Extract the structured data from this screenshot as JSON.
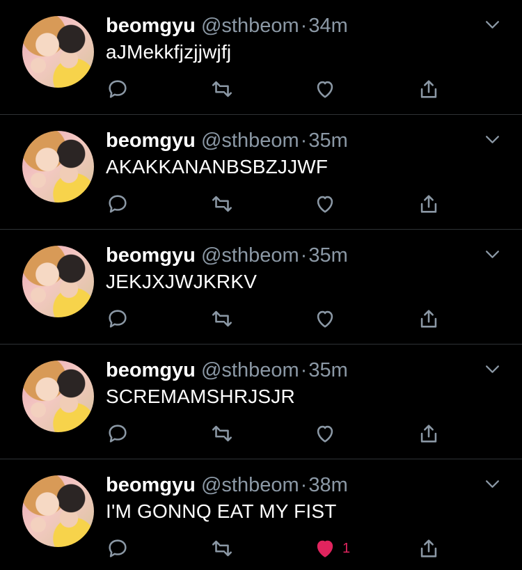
{
  "colors": {
    "background": "#000000",
    "text": "#ffffff",
    "secondary": "#8b98a5",
    "divider": "#2f3336",
    "liked": "#e0245e"
  },
  "icons": {
    "reply": "reply-icon",
    "retweet": "retweet-icon",
    "like": "heart-icon",
    "share": "share-icon",
    "menu": "chevron-down-icon"
  },
  "tweets": [
    {
      "name": "beomgyu",
      "handle": "@sthbeom",
      "separator": "·",
      "time": "34m",
      "text": "aJMekkfjzjjwjfj",
      "likes": "",
      "liked": false
    },
    {
      "name": "beomgyu",
      "handle": "@sthbeom",
      "separator": "·",
      "time": "35m",
      "text": "AKAKKANANBSBZJJWF",
      "likes": "",
      "liked": false
    },
    {
      "name": "beomgyu",
      "handle": "@sthbeom",
      "separator": "·",
      "time": "35m",
      "text": "JEKJXJWJKRKV",
      "likes": "",
      "liked": false
    },
    {
      "name": "beomgyu",
      "handle": "@sthbeom",
      "separator": "·",
      "time": "35m",
      "text": "SCREMAMSHRJSJR",
      "likes": "",
      "liked": false
    },
    {
      "name": "beomgyu",
      "handle": "@sthbeom",
      "separator": "·",
      "time": "38m",
      "text": "I'M GONNQ EAT MY FIST",
      "likes": "1",
      "liked": true
    }
  ]
}
